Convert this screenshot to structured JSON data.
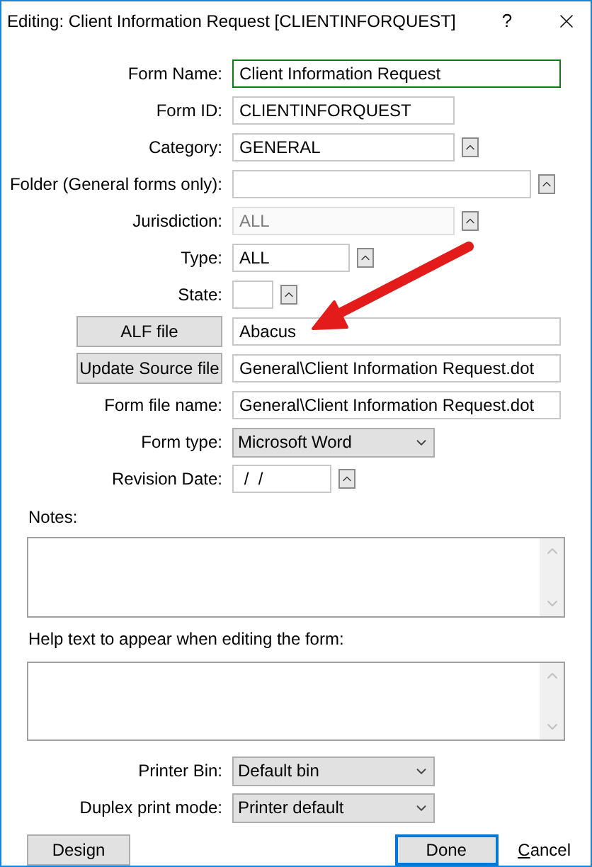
{
  "window": {
    "title": "Editing: Client Information Request [CLIENTINFORQUEST]",
    "help": "?"
  },
  "fields": [
    {
      "kind": "text",
      "label": "Form Name:",
      "value": "Client Information Request",
      "focused": true,
      "disabled": false
    },
    {
      "kind": "text",
      "label": "Form ID:",
      "value": "CLIENTINFORQUEST",
      "focused": false,
      "disabled": false
    },
    {
      "kind": "lookup",
      "label": "Category:",
      "value": "GENERAL",
      "focused": false,
      "disabled": false
    },
    {
      "kind": "lookup",
      "label": "Folder (General forms only):",
      "focused": false,
      "disabled": false
    },
    {
      "kind": "lookup",
      "label": "Jurisdiction:",
      "value": "ALL",
      "focused": false,
      "disabled": true
    },
    {
      "kind": "lookup",
      "label": "Type:",
      "value": "ALL",
      "focused": false,
      "disabled": false
    },
    {
      "kind": "lookup",
      "label": "State:",
      "focused": false,
      "disabled": false
    },
    {
      "kind": "button",
      "label": "ALF file",
      "value": "Abacus",
      "focused": false,
      "disabled": false
    },
    {
      "kind": "button",
      "label": "Update Source file",
      "value": "General\\Client Information Request.dot",
      "focused": false,
      "disabled": false
    },
    {
      "kind": "text",
      "label": "Form file name:",
      "value": "General\\Client Information Request.dot",
      "focused": false,
      "disabled": false
    },
    {
      "kind": "select",
      "label": "Form type:",
      "value": "Microsoft Word",
      "focused": false,
      "disabled": false
    },
    {
      "kind": "lookup",
      "label": "Revision Date:",
      "value": " /  /",
      "focused": false,
      "disabled": false
    }
  ],
  "notes": {
    "label": "Notes:"
  },
  "help_text": {
    "label": "Help text to appear when editing the form:"
  },
  "print": [
    {
      "label": "Printer Bin:",
      "value": "Default bin"
    },
    {
      "label": "Duplex print mode:",
      "value": "Printer default"
    }
  ],
  "buttons": [
    {
      "kind": "button",
      "label": "Design",
      "default": false
    },
    {
      "kind": "button",
      "label": "Done",
      "default": true
    },
    {
      "kind": "link",
      "label": "Cancel",
      "default": false
    }
  ]
}
